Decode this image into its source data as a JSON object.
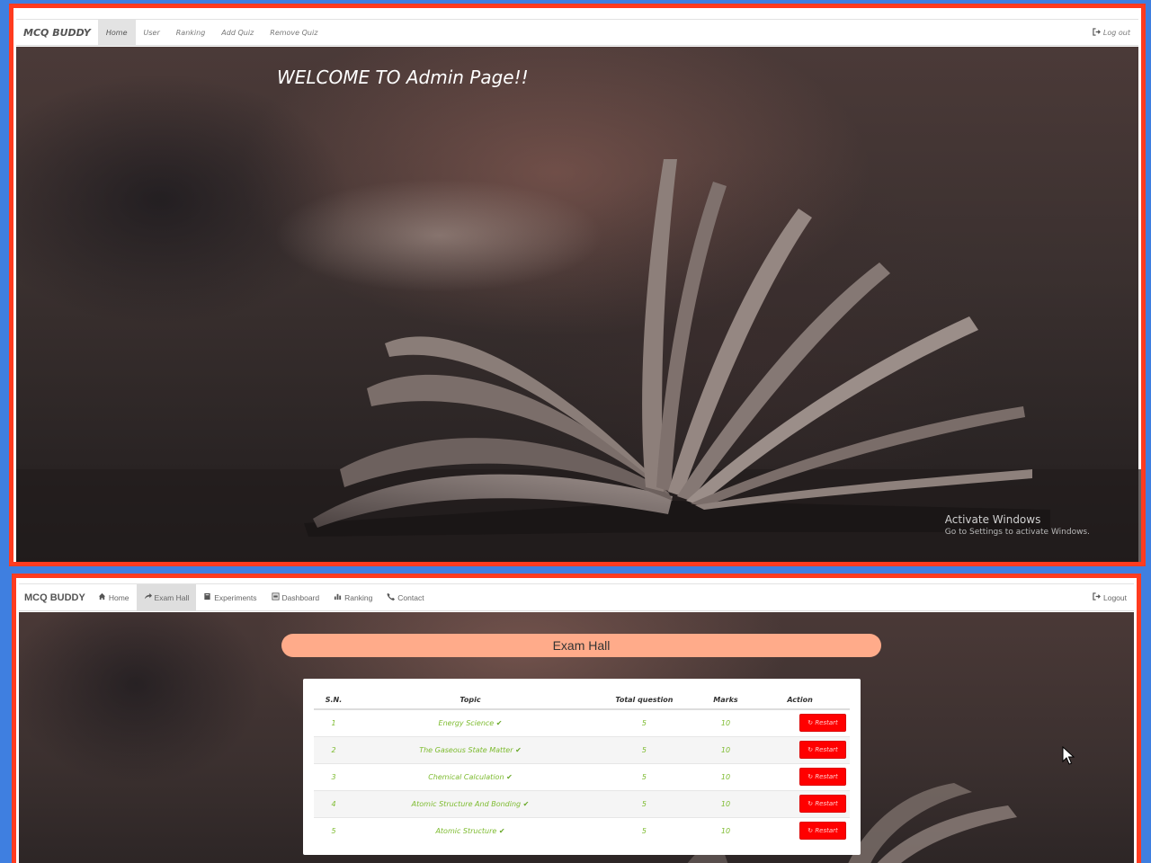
{
  "admin": {
    "brand": "MCQ BUDDY",
    "nav": [
      "Home",
      "User",
      "Ranking",
      "Add Quiz",
      "Remove Quiz"
    ],
    "active": "Home",
    "logout": "Log out",
    "welcome": "WELCOME TO Admin Page!!"
  },
  "os_watermark": {
    "title": "Activate Windows",
    "subtitle": "Go to Settings to activate Windows."
  },
  "user": {
    "brand": "MCQ BUDDY",
    "nav": [
      "Home",
      "Exam Hall",
      "Experiments",
      "Dashboard",
      "Ranking",
      "Contact"
    ],
    "active": "Exam Hall",
    "logout": "Logout",
    "exam_title": "Exam Hall",
    "table": {
      "headers": [
        "S.N.",
        "Topic",
        "Total question",
        "Marks",
        "Action"
      ],
      "rows": [
        {
          "sn": "1",
          "topic": "Energy Science",
          "total": "5",
          "marks": "10",
          "action": "Restart"
        },
        {
          "sn": "2",
          "topic": "The Gaseous State Matter",
          "total": "5",
          "marks": "10",
          "action": "Restart"
        },
        {
          "sn": "3",
          "topic": "Chemical Calculation",
          "total": "5",
          "marks": "10",
          "action": "Restart"
        },
        {
          "sn": "4",
          "topic": "Atomic Structure And Bonding",
          "total": "5",
          "marks": "10",
          "action": "Restart"
        },
        {
          "sn": "5",
          "topic": "Atomic Structure",
          "total": "5",
          "marks": "10",
          "action": "Restart"
        }
      ]
    }
  },
  "colors": {
    "frame": "#ff3b1f",
    "background": "#3f7fe0",
    "pill": "#ffab8a",
    "restart": "#ff0000",
    "topic_green": "#7dbb2f"
  }
}
